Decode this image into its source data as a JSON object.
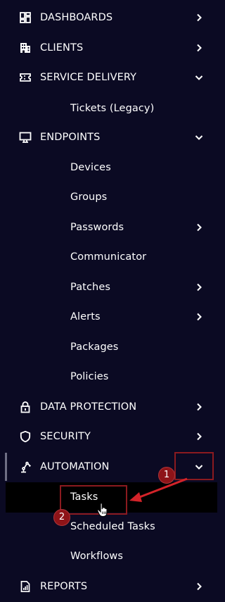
{
  "sidebar": {
    "items": [
      {
        "label": "DASHBOARDS",
        "icon": "dashboard-icon"
      },
      {
        "label": "CLIENTS",
        "icon": "building-icon"
      },
      {
        "label": "SERVICE DELIVERY",
        "icon": "ticket-icon"
      },
      {
        "label": "Tickets (Legacy)"
      },
      {
        "label": "ENDPOINTS",
        "icon": "monitor-icon"
      },
      {
        "label": "Devices"
      },
      {
        "label": "Groups"
      },
      {
        "label": "Passwords"
      },
      {
        "label": "Communicator"
      },
      {
        "label": "Patches"
      },
      {
        "label": "Alerts"
      },
      {
        "label": "Packages"
      },
      {
        "label": "Policies"
      },
      {
        "label": "DATA PROTECTION",
        "icon": "lock-icon"
      },
      {
        "label": "SECURITY",
        "icon": "shield-icon"
      },
      {
        "label": "AUTOMATION",
        "icon": "robot-arm-icon"
      },
      {
        "label": "Tasks"
      },
      {
        "label": "Scheduled Tasks"
      },
      {
        "label": "Workflows"
      },
      {
        "label": "REPORTS",
        "icon": "report-icon"
      }
    ]
  },
  "annotations": {
    "step1": "1",
    "step2": "2"
  },
  "colors": {
    "background": "#0b0a23",
    "selected_background": "#000000",
    "annotation_red": "#8e1418",
    "text": "#ffffff"
  }
}
